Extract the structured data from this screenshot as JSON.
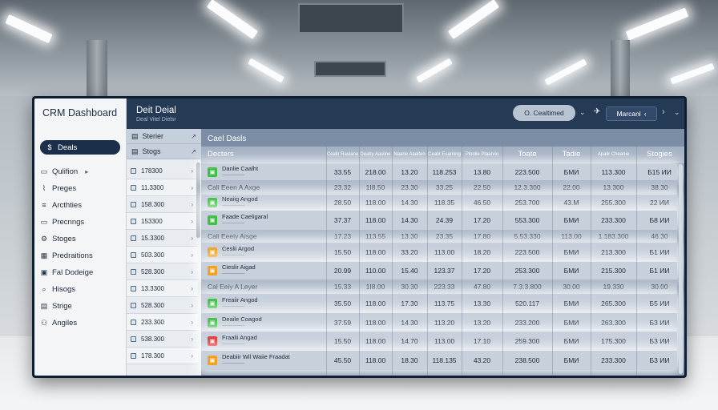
{
  "app": {
    "title": "CRM Dashboard"
  },
  "sidebar": {
    "items": [
      {
        "icon": "dollar-icon",
        "glyph": "$",
        "label": "Deals"
      },
      {
        "icon": "funnel-icon",
        "glyph": "▭",
        "label": "Qulifion",
        "chevron": "▸"
      },
      {
        "icon": "chart-icon",
        "glyph": "⌇",
        "label": "Preges"
      },
      {
        "icon": "bars-icon",
        "glyph": "≡",
        "label": "Arcthties"
      },
      {
        "icon": "calendar-icon",
        "glyph": "▭",
        "label": "Precnngs"
      },
      {
        "icon": "settings-icon",
        "glyph": "⚙",
        "label": "Stoges"
      },
      {
        "icon": "grid-icon",
        "glyph": "▦",
        "label": "Predraitions"
      },
      {
        "icon": "folder-icon",
        "glyph": "▣",
        "label": "Fal Dodeige"
      },
      {
        "icon": "search-icon",
        "glyph": "⌕",
        "label": "Hisogs"
      },
      {
        "icon": "document-icon",
        "glyph": "▤",
        "label": "Strige"
      },
      {
        "icon": "people-icon",
        "glyph": "⚇",
        "label": "Angiles"
      }
    ]
  },
  "header": {
    "title": "Deit Deial",
    "subtitle": "Deal Vitel Dielsr",
    "pill": "O. Cealtimed",
    "select": "Marcanl"
  },
  "sublist": {
    "header1": "Sterier",
    "header2": "Stogs",
    "rows": [
      "178300",
      "11.3300",
      "158.300",
      "153300",
      "15.3300",
      "503.300",
      "528.300",
      "13.3300",
      "528.300",
      "233.300",
      "538.300",
      "178.300"
    ]
  },
  "main": {
    "title": "Cael Dasls",
    "columns": [
      "Decters",
      "Cealir Rasiane",
      "Deatiy Aasiine",
      "Naarie Aaalten",
      "Cealir Esaming",
      "Ploolle Plaarvio",
      "Toate",
      "Tadie",
      "Apalir Cheanie",
      "Stogies"
    ],
    "rows": [
      {
        "type": "deal",
        "badge": "green",
        "name": "Danlie Caalht",
        "values": [
          "33.55",
          "218.00",
          "13.20",
          "118.253",
          "13.80",
          "223.500",
          "БМИ",
          "113.300",
          "Б15 ИИ"
        ]
      },
      {
        "type": "band",
        "label": "Cali Eeen A Axge",
        "values": [
          "23.32",
          "1I8.50",
          "23.30",
          "33.25",
          "22.50",
          "12.3.300",
          "22.00",
          "13.300",
          "38.30"
        ]
      },
      {
        "type": "deal",
        "badge": "green",
        "name": "Neaiig Angod",
        "values": [
          "28.50",
          "118.00",
          "14.30",
          "118.35",
          "46.50",
          "253.700",
          "43.M",
          "255.300",
          "22 ИИ"
        ]
      },
      {
        "type": "deal",
        "badge": "green",
        "name": "Faade Caeligaral",
        "values": [
          "37.37",
          "118.00",
          "14.30",
          "24.39",
          "17.20",
          "553.300",
          "БМИ",
          "233.300",
          "Б8 ИИ"
        ]
      },
      {
        "type": "band",
        "label": "Cali Eeeiy Aisge",
        "values": [
          "17.23",
          "113.55",
          "13.30",
          "23.35",
          "17.80",
          "5.53.330",
          "113.00",
          "1.183.300",
          "46.30"
        ]
      },
      {
        "type": "deal",
        "badge": "orange",
        "name": "Ceslii Argod",
        "values": [
          "15.50",
          "118.00",
          "33.20",
          "113.00",
          "18.20",
          "223.500",
          "БМИ",
          "213.300",
          "Б1 ИИ"
        ]
      },
      {
        "type": "deal",
        "badge": "orange",
        "name": "Cieslir Aigad",
        "values": [
          "20.99",
          "110.00",
          "15.40",
          "123.37",
          "17.20",
          "253.300",
          "БМИ",
          "215.300",
          "Б1 ИИ"
        ]
      },
      {
        "type": "band",
        "label": "Cal Eeiy A Leyer",
        "values": [
          "15.33",
          "1I8.00",
          "30.30",
          "223.33",
          "47.80",
          "7.3.3.800",
          "30.00",
          "19.330",
          "30.00"
        ]
      },
      {
        "type": "deal",
        "badge": "green",
        "name": "Freaiir Angod",
        "values": [
          "35.50",
          "118.00",
          "17.30",
          "113.75",
          "13.30",
          "520.117",
          "БМИ",
          "265.300",
          "Б5 ИИ"
        ]
      },
      {
        "type": "deal",
        "badge": "green",
        "name": "Deaile Coagod",
        "values": [
          "37.59",
          "118.00",
          "14.30",
          "113.20",
          "13.20",
          "233.200",
          "БМИ",
          "263.300",
          "Б3 ИИ"
        ]
      },
      {
        "type": "deal",
        "badge": "red",
        "name": "Fraalii Angad",
        "values": [
          "15.50",
          "118.00",
          "14.70",
          "113.00",
          "17.10",
          "259.300",
          "БМИ",
          "175.300",
          "Б3 ИИ"
        ]
      },
      {
        "type": "deal",
        "badge": "orange",
        "name": "Deabiir Wil Waiie Fraadat",
        "values": [
          "45.50",
          "118.00",
          "18.30",
          "118.135",
          "43.20",
          "238.500",
          "БМИ",
          "233.300",
          "Б3 ИИ"
        ]
      }
    ]
  },
  "colors": {
    "header": "#253a55",
    "active": "#1c2f4a",
    "green": "#3fbf46",
    "orange": "#f0a227",
    "red": "#e03a3a"
  }
}
